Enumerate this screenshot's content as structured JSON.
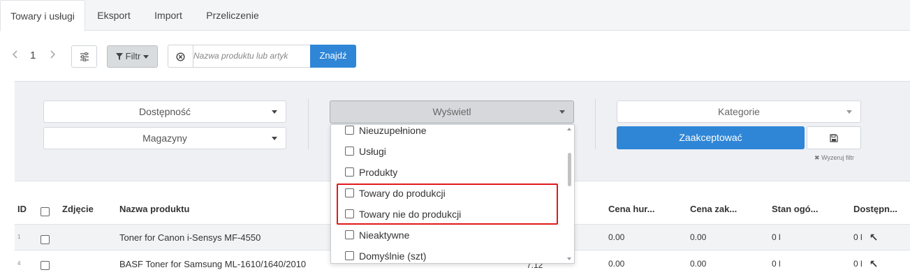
{
  "tabs": [
    {
      "label": "Towary i usługi",
      "active": true
    },
    {
      "label": "Eksport",
      "active": false
    },
    {
      "label": "Import",
      "active": false
    },
    {
      "label": "Przeliczenie",
      "active": false
    }
  ],
  "toolbar": {
    "page": "1",
    "filter_label": "Filtr",
    "search_placeholder": "Nazwa produktu lub artyk",
    "find_label": "Znajdź"
  },
  "filters": {
    "availability": "Dostępność",
    "warehouses": "Magazyny",
    "display": "Wyświetl",
    "categories": "Kategorie",
    "accept_label": "Zaakceptować",
    "reset_label": "Wyzeruj filtr"
  },
  "display_options": [
    {
      "label": "Nieuzupełnione",
      "checked": false
    },
    {
      "label": "Usługi",
      "checked": false
    },
    {
      "label": "Produkty",
      "checked": false
    },
    {
      "label": "Towary do produkcji",
      "checked": false
    },
    {
      "label": "Towary nie do produkcji",
      "checked": false
    },
    {
      "label": "Nieaktywne",
      "checked": false
    },
    {
      "label": "Domyślnie (szt)",
      "checked": false
    }
  ],
  "table": {
    "headers": {
      "id": "ID",
      "photo": "Zdjęcie",
      "name": "Nazwa produktu",
      "wholesale": "Cena hur...",
      "purchase": "Cena zak...",
      "stock": "Stan ogó...",
      "available": "Dostępn..."
    },
    "rows": [
      {
        "id": "1",
        "name": "Toner for Canon i-Sensys MF-4550",
        "price": "",
        "wholesale": "0.00",
        "purchase": "0.00",
        "stock": "0 l",
        "available": "0 l"
      },
      {
        "id": "4",
        "name": "BASF Toner for Samsung ML-1610/1640/2010",
        "price": "7.12",
        "wholesale": "0.00",
        "purchase": "0.00",
        "stock": "0 l",
        "available": "0 l"
      }
    ]
  },
  "colors": {
    "accent": "#2f86d6",
    "highlight": "#e11919",
    "panel_bg": "#eef0f4"
  }
}
